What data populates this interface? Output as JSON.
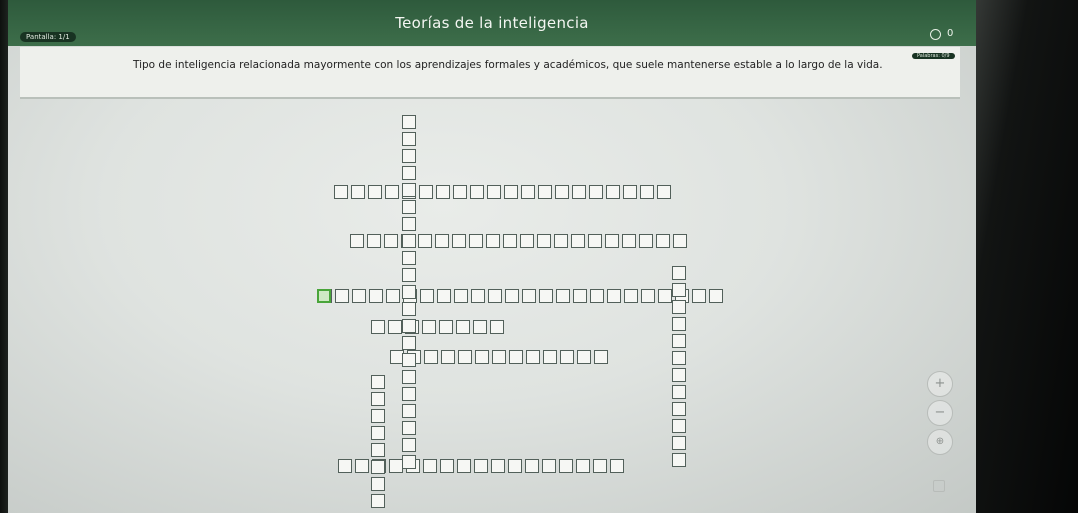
{
  "header": {
    "title": "Teorías de la inteligencia",
    "screen_counter": "Pantalla: 1/1",
    "score": "0",
    "words_counter": "Palabras: 0/9"
  },
  "question": {
    "text": "Tipo de inteligencia relacionada mayormente con los aprendizajes formales y académicos, que suele mantenerse estable a lo largo de la vida."
  },
  "controls": {
    "zoom_in": "+",
    "zoom_out": "−",
    "zoom_reset": "⊕"
  },
  "colors": {
    "header_green": "#3d6e4a",
    "active_cell": "#49a53a"
  }
}
